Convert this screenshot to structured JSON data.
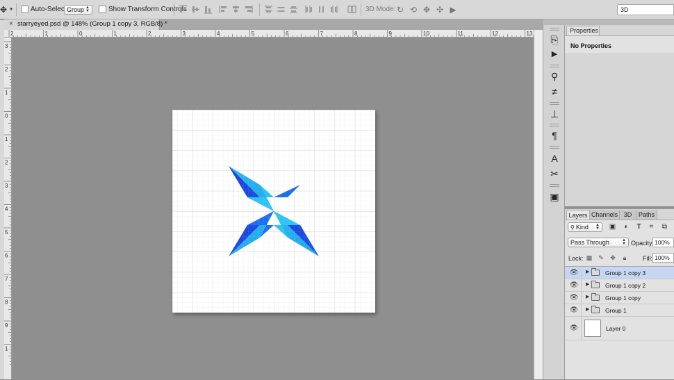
{
  "options_bar": {
    "tool": "move-tool",
    "auto_select_label": "Auto-Select:",
    "auto_select_value": "Group",
    "show_transform_label": "Show Transform Controls",
    "mode_3d_label": "3D Mode:",
    "workspace_value": "3D"
  },
  "document": {
    "tab_title": "starryeyed.psd @ 148% (Group 1 copy 3, RGB/8) *",
    "close_glyph": "×",
    "ruler_top": [
      "2",
      "1",
      "0",
      "1",
      "2",
      "3",
      "4",
      "5",
      "6",
      "7",
      "8",
      "9",
      "10",
      "11",
      "12",
      "13"
    ],
    "ruler_left": [
      "3",
      "2",
      "1",
      "0",
      "1",
      "2",
      "3",
      "4",
      "5",
      "6",
      "7",
      "8",
      "9",
      "1"
    ]
  },
  "properties": {
    "tab": "Properties",
    "message": "No Properties"
  },
  "layers_panel": {
    "tabs": [
      "Layers",
      "Channels",
      "3D",
      "Paths"
    ],
    "kind_label": "Kind",
    "blend_mode": "Pass Through",
    "opacity_label": "Opacity:",
    "opacity_value": "100%",
    "lock_label": "Lock:",
    "fill_label": "Fill:",
    "fill_value": "100%",
    "layers": [
      {
        "name": "Group 1 copy 3",
        "type": "group",
        "selected": true
      },
      {
        "name": "Group 1 copy 2",
        "type": "group",
        "selected": false
      },
      {
        "name": "Group 1 copy",
        "type": "group",
        "selected": false
      },
      {
        "name": "Group 1",
        "type": "group",
        "selected": false
      },
      {
        "name": "Layer 0",
        "type": "pixel",
        "selected": false
      }
    ]
  },
  "colors": {
    "star_light": "#2bb6f2",
    "star_dark": "#1a3fd8",
    "selection": "#c6d7f4"
  }
}
